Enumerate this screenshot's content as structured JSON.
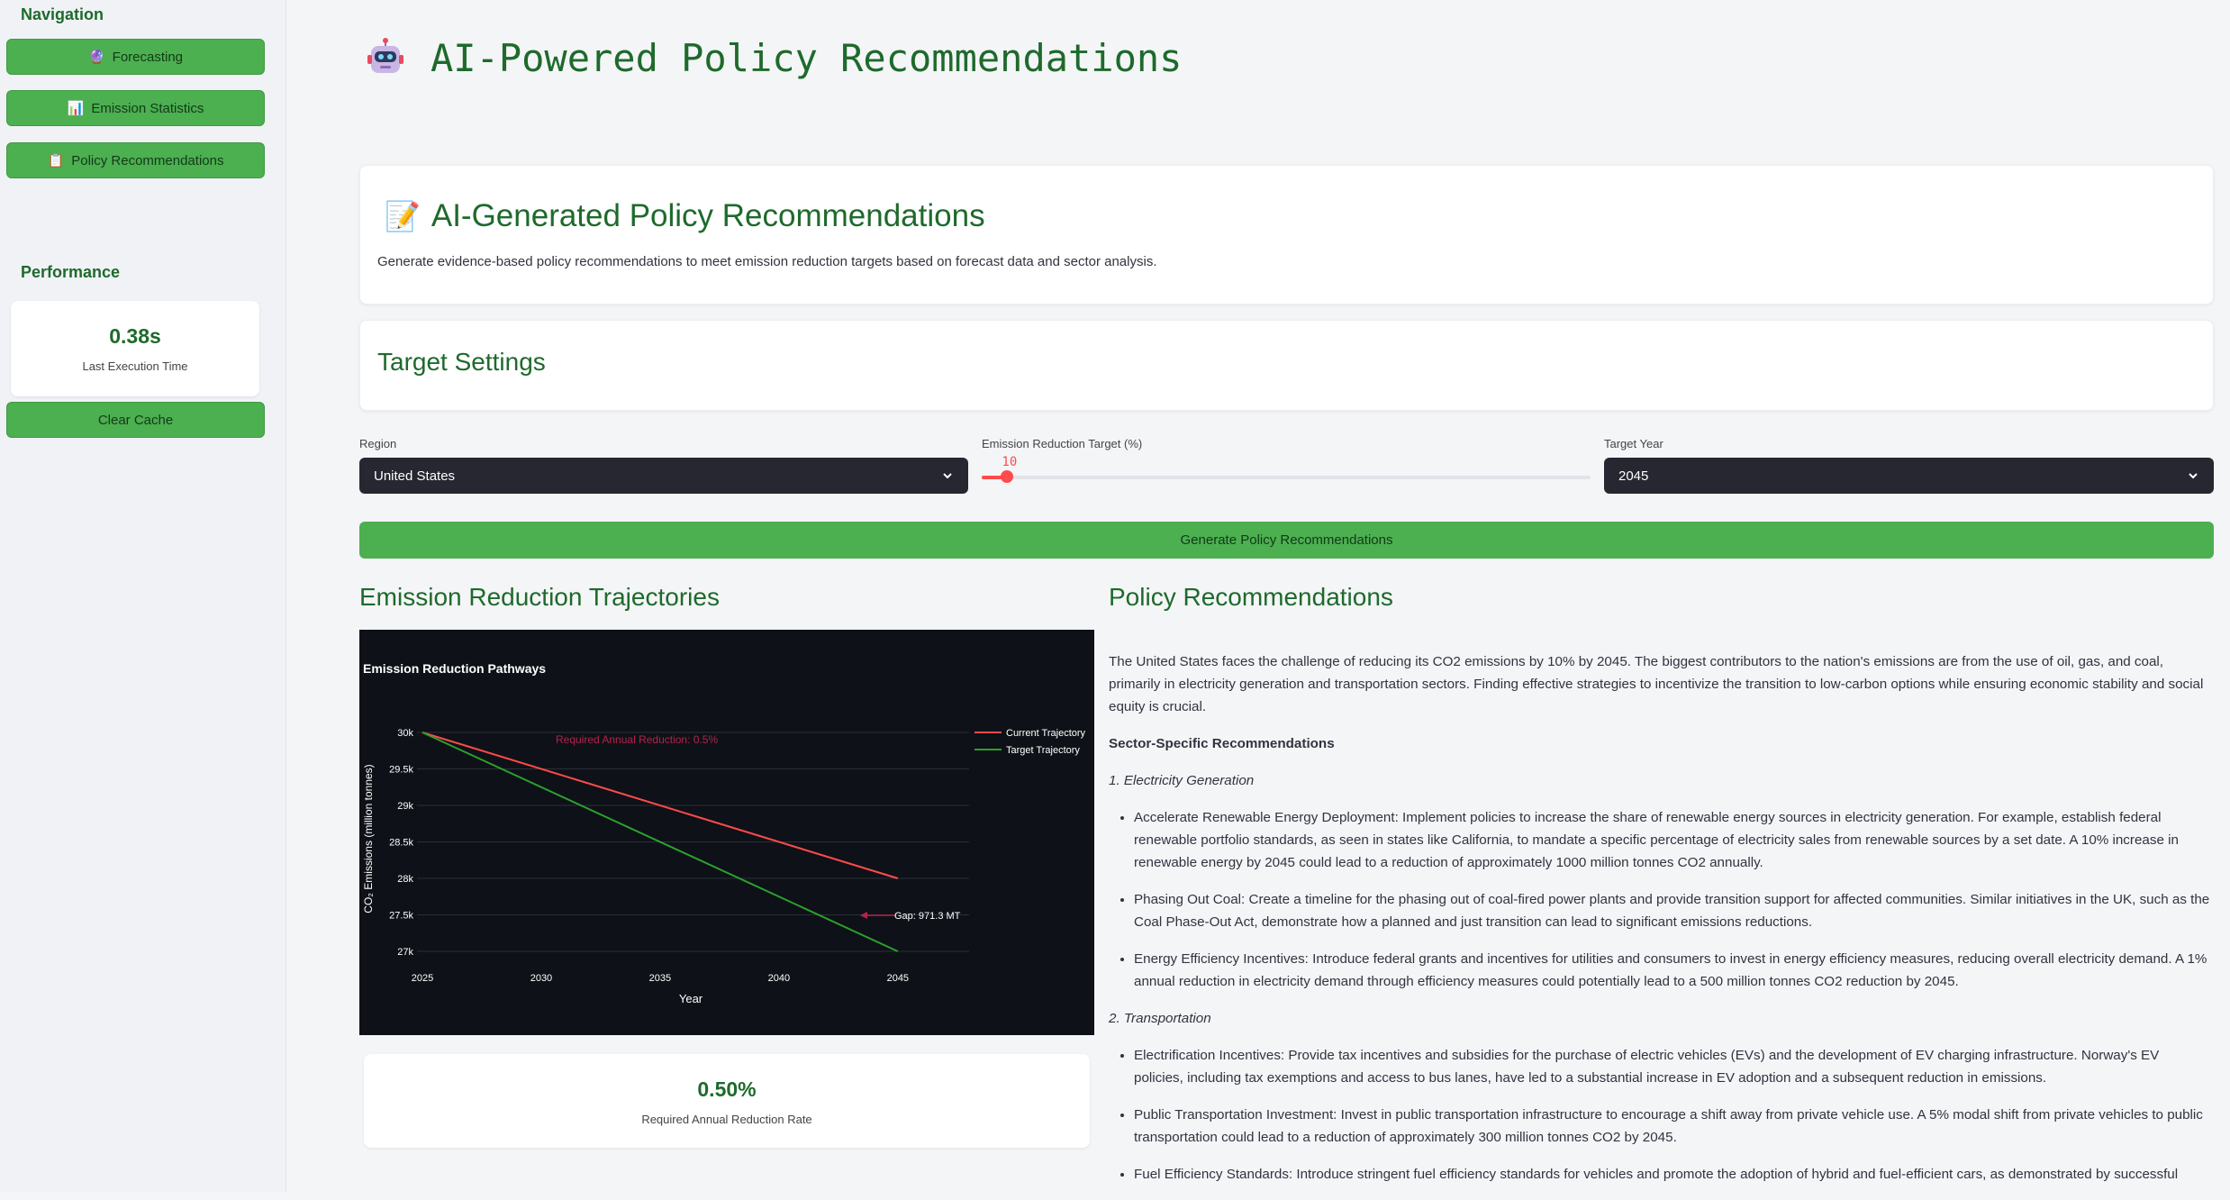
{
  "sidebar": {
    "nav_heading": "Navigation",
    "items": [
      {
        "label": "Forecasting",
        "icon": "crystal-ball-icon",
        "emoji": "🔮"
      },
      {
        "label": "Emission Statistics",
        "icon": "bar-chart-icon",
        "emoji": "📊"
      },
      {
        "label": "Policy Recommendations",
        "icon": "clipboard-icon",
        "emoji": "📋"
      }
    ],
    "performance_heading": "Performance",
    "performance": {
      "value": "0.38s",
      "label": "Last Execution Time"
    },
    "clear_cache": "Clear Cache"
  },
  "page": {
    "title": "AI-Powered Policy Recommendations",
    "title_icon": "robot-icon"
  },
  "intro_card": {
    "emoji": "📝",
    "icon": "memo-icon",
    "title": "AI-Generated Policy Recommendations",
    "description": "Generate evidence-based policy recommendations to meet emission reduction targets based on forecast data and sector analysis."
  },
  "target_settings": {
    "title": "Target Settings",
    "region": {
      "label": "Region",
      "value": "United States"
    },
    "reduction": {
      "label": "Emission Reduction Target (%)",
      "value": "10",
      "fraction": 0.1
    },
    "year": {
      "label": "Target Year",
      "value": "2045"
    }
  },
  "generate_button": "Generate Policy Recommendations",
  "trajectories": {
    "heading": "Emission Reduction Trajectories",
    "metric": {
      "value": "0.50%",
      "label": "Required Annual Reduction Rate"
    }
  },
  "chart_data": {
    "type": "line",
    "title": "Emission Reduction Pathways",
    "xlabel": "Year",
    "ylabel": "CO₂ Emissions (million tonnes)",
    "x_ticks": [
      "2025",
      "2030",
      "2035",
      "2040",
      "2045"
    ],
    "y_ticks": [
      "27k",
      "27.5k",
      "28k",
      "28.5k",
      "29k",
      "29.5k",
      "30k"
    ],
    "xlim": [
      2025,
      2048
    ],
    "ylim": [
      27000,
      30000
    ],
    "grid": true,
    "legend_position": "right",
    "series": [
      {
        "name": "Current Trajectory",
        "color": "#ff4b4b",
        "x": [
          2025,
          2045
        ],
        "y": [
          30000,
          28000
        ]
      },
      {
        "name": "Target Trajectory",
        "color": "#2ca02c",
        "x": [
          2025,
          2045
        ],
        "y": [
          30000,
          27000
        ]
      }
    ],
    "annotations": [
      {
        "text": "Required Annual Reduction: 0.5%",
        "color": "#b3244a"
      },
      {
        "text": "Gap: 971.3 MT",
        "color": "#ffffff"
      }
    ]
  },
  "policy": {
    "heading": "Policy Recommendations",
    "intro": "The United States faces the challenge of reducing its CO2 emissions by 10% by 2045. The biggest contributors to the nation's emissions are from the use of oil, gas, and coal, primarily in electricity generation and transportation sectors. Finding effective strategies to incentivize the transition to low-carbon options while ensuring economic stability and social equity is crucial.",
    "sector_heading": "Sector-Specific Recommendations",
    "sections": [
      {
        "title": "1. Electricity Generation",
        "items": [
          "Accelerate Renewable Energy Deployment: Implement policies to increase the share of renewable energy sources in electricity generation. For example, establish federal renewable portfolio standards, as seen in states like California, to mandate a specific percentage of electricity sales from renewable sources by a set date. A 10% increase in renewable energy by 2045 could lead to a reduction of approximately 1000 million tonnes CO2 annually.",
          "Phasing Out Coal: Create a timeline for the phasing out of coal-fired power plants and provide transition support for affected communities. Similar initiatives in the UK, such as the Coal Phase-Out Act, demonstrate how a planned and just transition can lead to significant emissions reductions.",
          "Energy Efficiency Incentives: Introduce federal grants and incentives for utilities and consumers to invest in energy efficiency measures, reducing overall electricity demand. A 1% annual reduction in electricity demand through efficiency measures could potentially lead to a 500 million tonnes CO2 reduction by 2045."
        ]
      },
      {
        "title": "2. Transportation",
        "items": [
          "Electrification Incentives: Provide tax incentives and subsidies for the purchase of electric vehicles (EVs) and the development of EV charging infrastructure. Norway's EV policies, including tax exemptions and access to bus lanes, have led to a substantial increase in EV adoption and a subsequent reduction in emissions.",
          "Public Transportation Investment: Invest in public transportation infrastructure to encourage a shift away from private vehicle use. A 5% modal shift from private vehicles to public transportation could lead to a reduction of approximately 300 million tonnes CO2 by 2045.",
          "Fuel Efficiency Standards: Introduce stringent fuel efficiency standards for vehicles and promote the adoption of hybrid and fuel-efficient cars, as demonstrated by successful"
        ]
      }
    ]
  }
}
